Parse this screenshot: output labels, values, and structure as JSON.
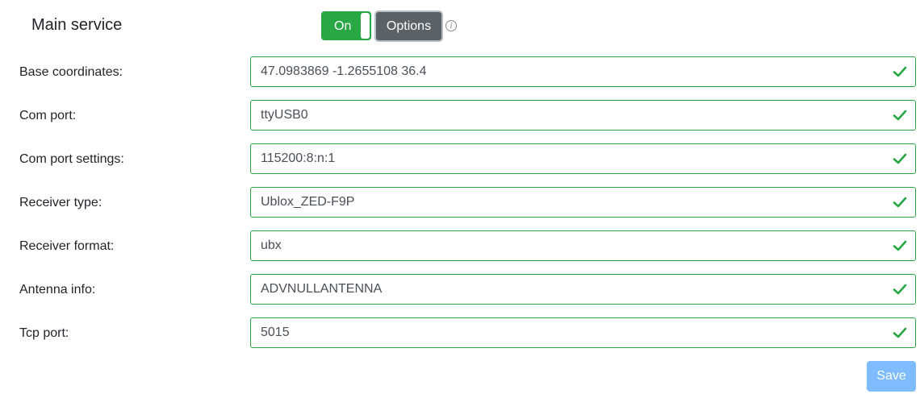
{
  "service": {
    "title": "Main service",
    "toggle_label": "On",
    "toggle_state": "on",
    "options_label": "Options",
    "info_icon": "info-icon"
  },
  "fields": [
    {
      "label": "Base coordinates:",
      "value": "47.0983869 -1.2655108 36.4",
      "valid": true
    },
    {
      "label": "Com port:",
      "value": "ttyUSB0",
      "valid": true
    },
    {
      "label": "Com port settings:",
      "value": "115200:8:n:1",
      "valid": true
    },
    {
      "label": "Receiver type:",
      "value": "Ublox_ZED-F9P",
      "valid": true
    },
    {
      "label": "Receiver format:",
      "value": "ubx",
      "valid": true
    },
    {
      "label": "Antenna info:",
      "value": "ADVNULLANTENNA",
      "valid": true
    },
    {
      "label": "Tcp port:",
      "value": "5015",
      "valid": true
    }
  ],
  "actions": {
    "save_label": "Save"
  },
  "colors": {
    "valid_green": "#28a745",
    "options_gray": "#5a6268",
    "save_blue_disabled": "#7fbcff"
  }
}
